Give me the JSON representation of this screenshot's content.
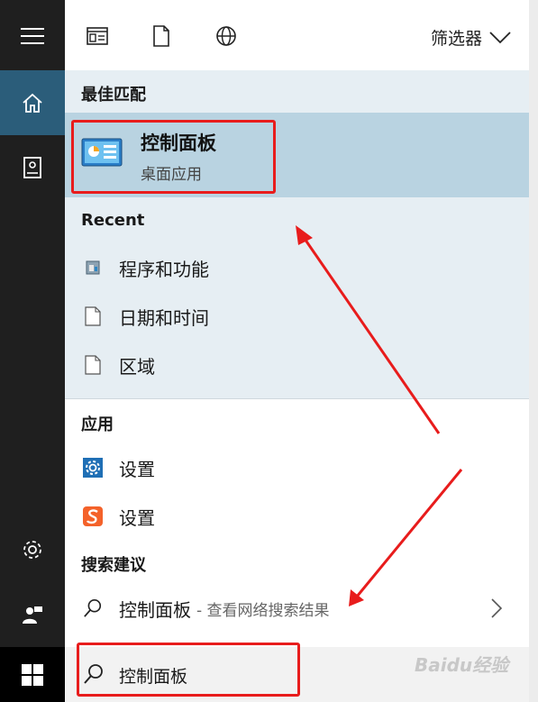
{
  "filter": {
    "label": "筛选器"
  },
  "sections": {
    "best_match": "最佳匹配",
    "recent": "Recent",
    "apps": "应用",
    "suggestions": "搜索建议"
  },
  "best_match": {
    "title": "控制面板",
    "subtitle": "桌面应用"
  },
  "recent_items": [
    {
      "label": "程序和功能",
      "icon": "programs-features-icon"
    },
    {
      "label": "日期和时间",
      "icon": "document-icon"
    },
    {
      "label": "区域",
      "icon": "document-icon"
    }
  ],
  "app_items": [
    {
      "label": "设置",
      "icon": "gear-icon"
    },
    {
      "label": "设置",
      "icon": "sogou-icon"
    }
  ],
  "suggestion": {
    "label": "控制面板",
    "suffix": " - 查看网络搜索结果"
  },
  "search": {
    "value": "控制面板"
  },
  "watermark": "Baidu经验",
  "colors": {
    "accent": "#2b5d7a",
    "highlight": "#b9d3e1",
    "annotation": "#e81c1c"
  }
}
